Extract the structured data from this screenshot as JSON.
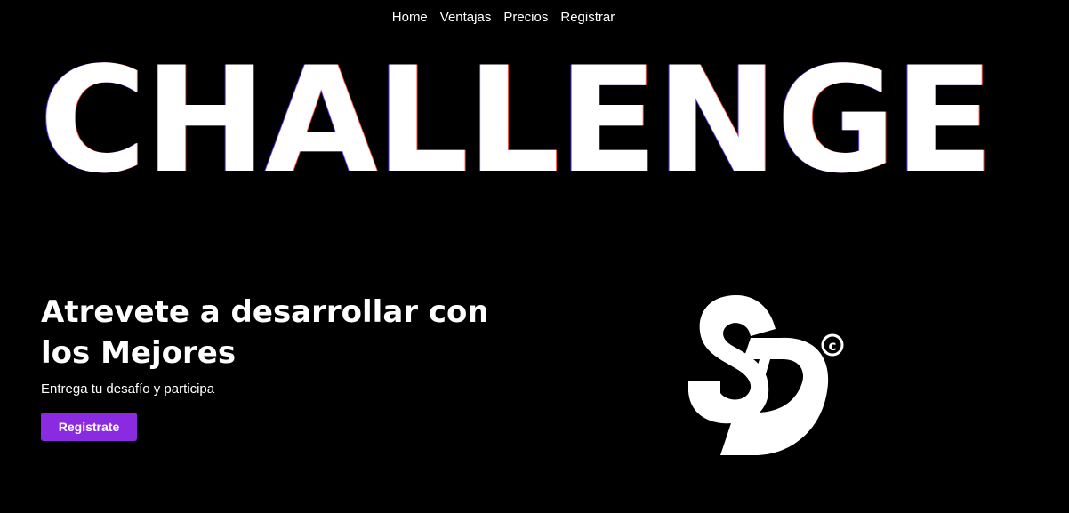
{
  "nav": {
    "items": [
      {
        "label": "Home"
      },
      {
        "label": "Ventajas"
      },
      {
        "label": "Precios"
      },
      {
        "label": "Registrar"
      }
    ]
  },
  "hero": {
    "title": "CHALLENGE",
    "headline": "Atrevete a desarrollar con los Mejores",
    "subtext": "Entrega tu desafío y participa",
    "cta_label": "Registrate"
  },
  "logo": {
    "icon": "sd-logo-icon",
    "copyright_symbol": "©"
  },
  "colors": {
    "background": "#000000",
    "text": "#ffffff",
    "accent": "#8a2be2"
  }
}
